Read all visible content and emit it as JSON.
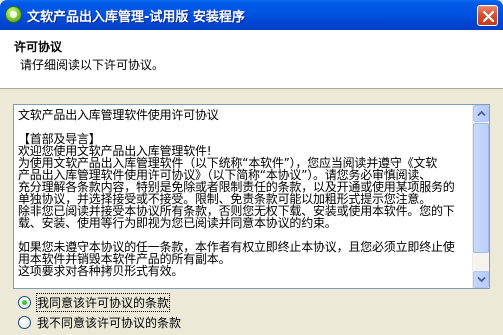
{
  "window": {
    "title": "文软产品出入库管理-试用版  安装程序"
  },
  "header": {
    "title": "许可协议",
    "subtitle": "请仔细阅读以下许可协议。"
  },
  "license": {
    "lines": [
      "文软产品出入库管理软件使用许可协议",
      "",
      "【首部及导言】",
      "欢迎您使用文软产品出入库管理软件!",
      "为使用文软产品出入库管理软件（以下统称“本软件”），您应当阅读并遵守《文软",
      "产品出入库管理软件使用许可协议》（以下简称“本协议”）。请您务必审慎阅读、",
      "充分理解各条款内容，特别是免除或者限制责任的条款，以及开通或使用某项服务的",
      "单独协议，并选择接受或不接受。限制、免责条款可能以加粗形式提示您注意。",
      "除非您已阅读并接受本协议所有条款，否则您无权下载、安装或使用本软件。您的下",
      "载、安装、使用等行为即视为您已阅读并同意本协议的约束。",
      "",
      "如果您未遵守本协议的任一条款，本作者有权立即终止本协议，且您必须立即终止使",
      "用本软件并销毁本软件产品的所有副本。",
      "这项要求对各种拷贝形式有效。"
    ]
  },
  "options": {
    "accept": "我同意该许可协议的条款",
    "decline": "我不同意该许可协议的条款",
    "selected": "accept"
  }
}
